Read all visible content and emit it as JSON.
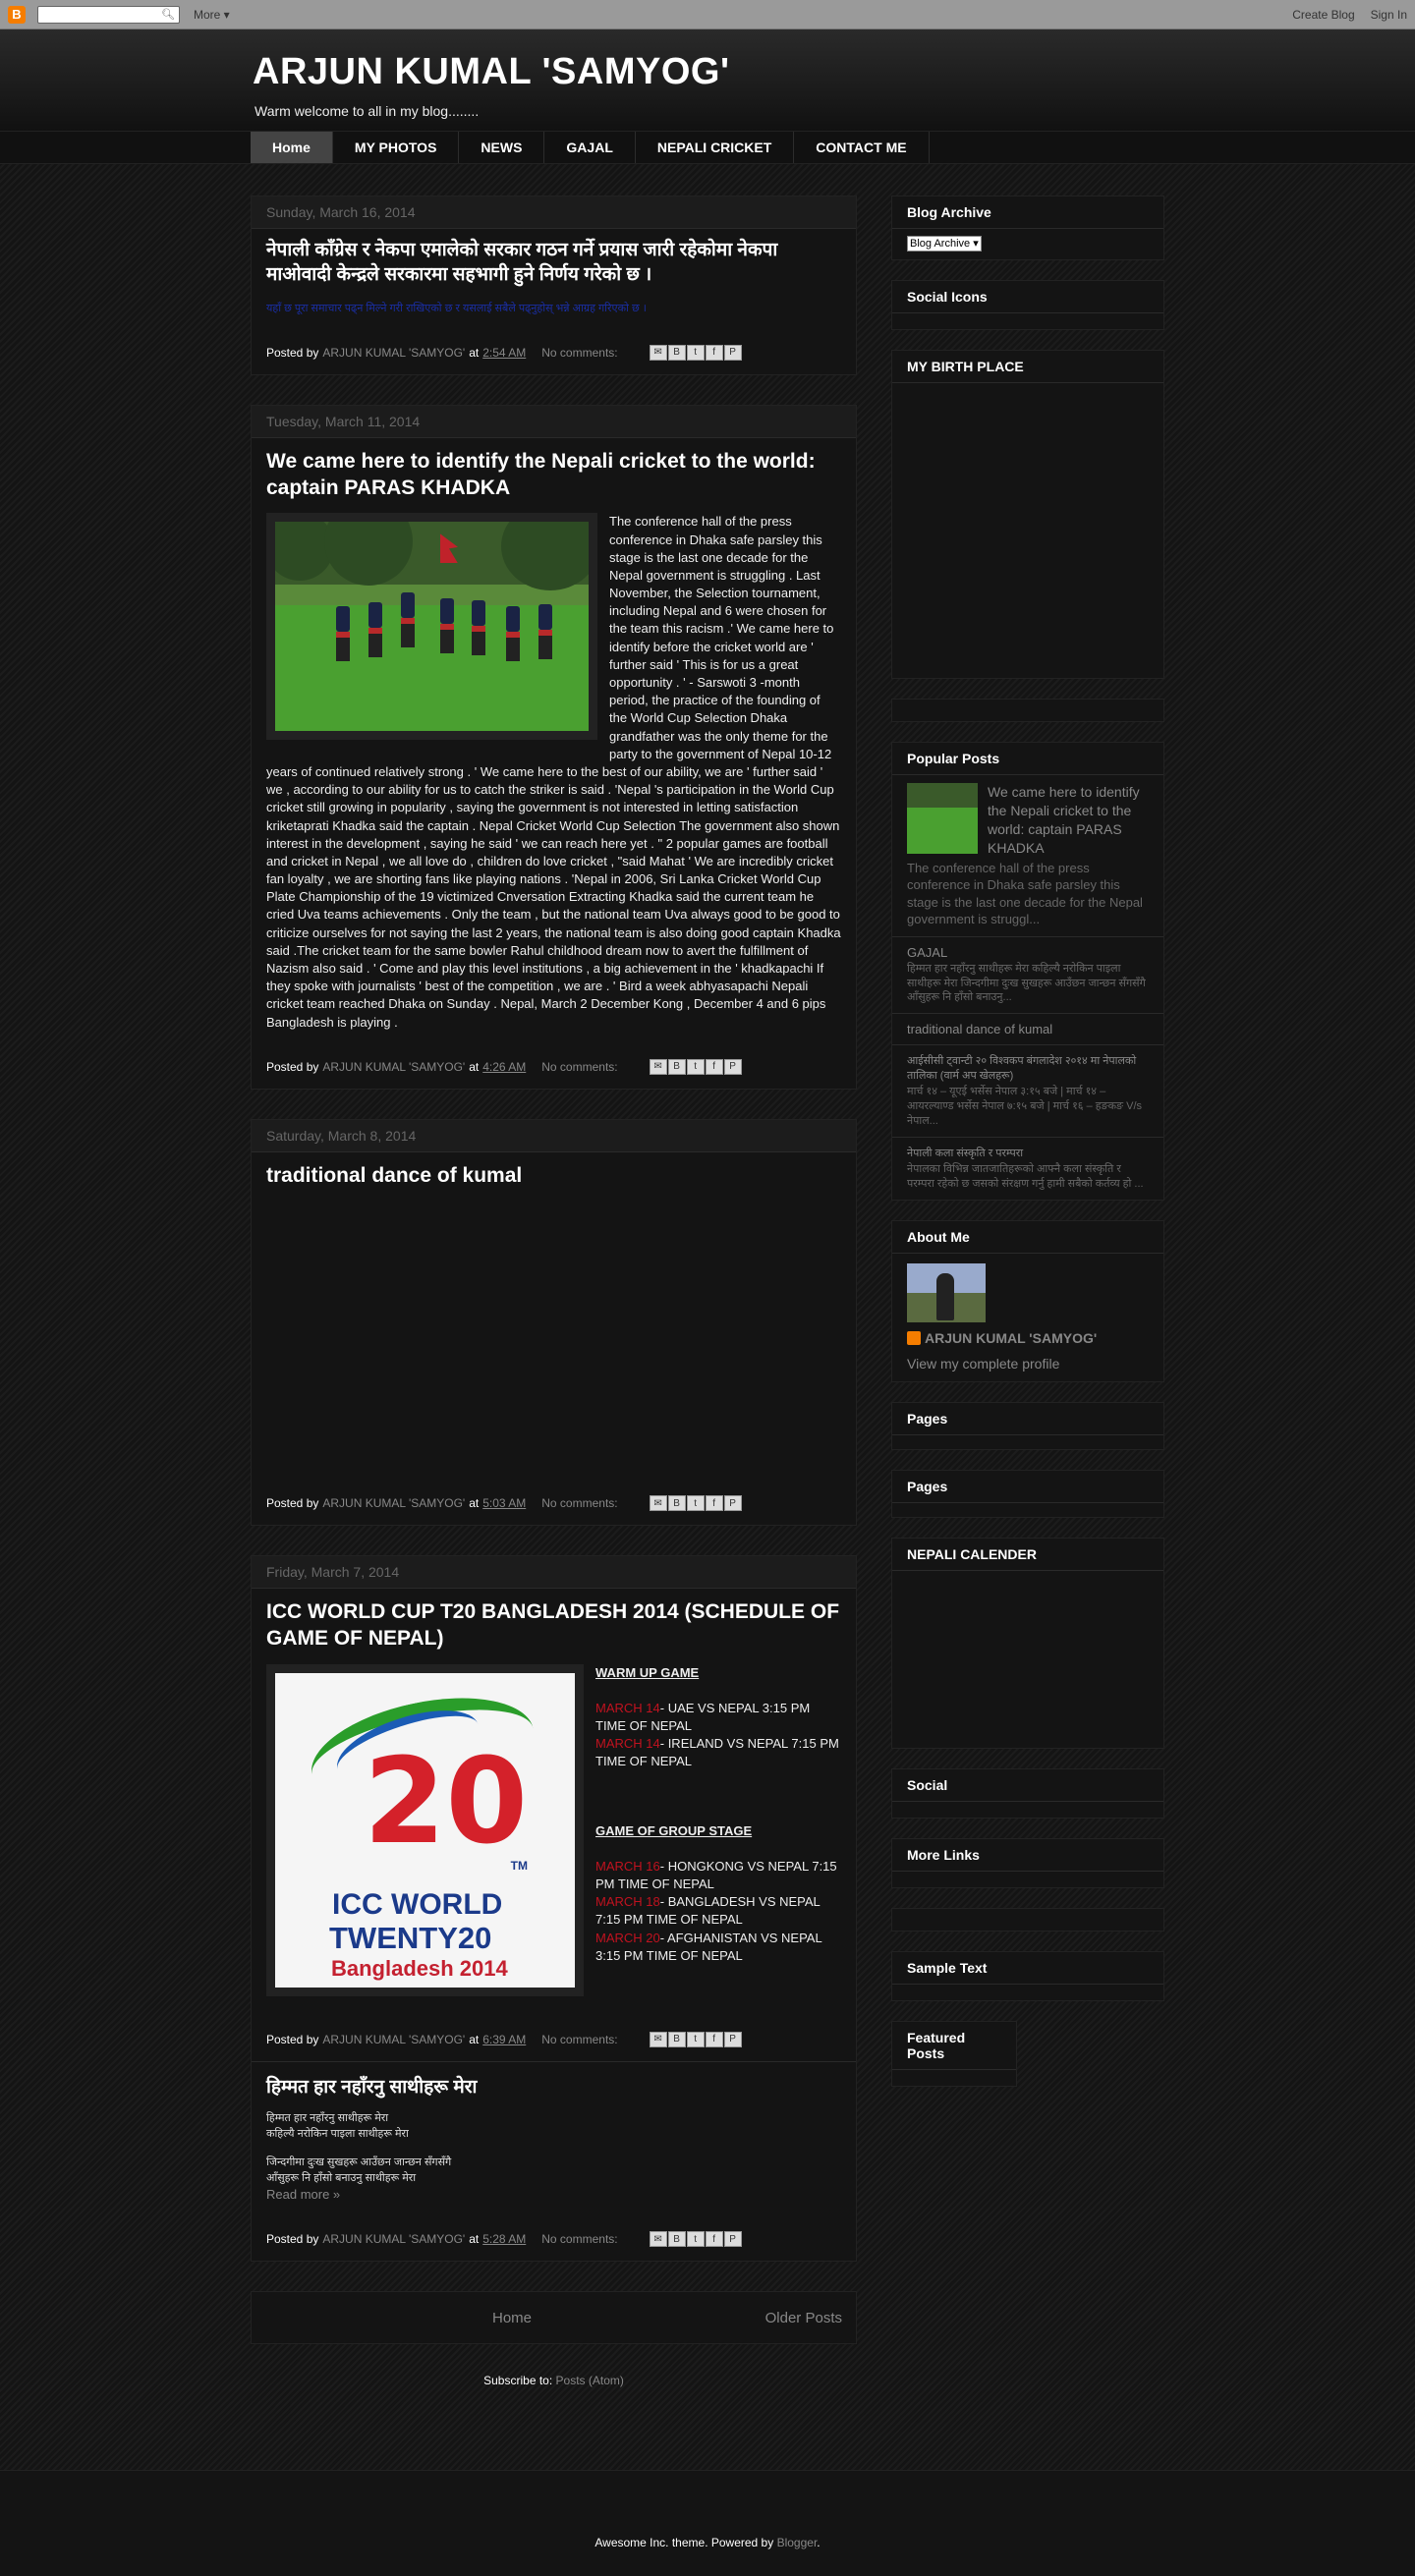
{
  "navbar": {
    "logo": "B",
    "more": "More",
    "create_blog": "Create Blog",
    "sign_in": "Sign In"
  },
  "header": {
    "title": "ARJUN KUMAL 'SAMYOG'",
    "description": "Warm welcome to all in my blog........"
  },
  "tabs": [
    "Home",
    "MY PHOTOS",
    "NEWS",
    "GAJAL",
    "NEPALI CRICKET",
    "CONTACT ME"
  ],
  "posts": [
    {
      "date": "Sunday, March 16, 2014",
      "title": "नेपाली काँग्रेस र नेकपा एमालेको सरकार गठन गर्ने प्रयास जारी रहेकोमा नेकपा माओवादी केन्द्रले सरकारमा सहभागी हुने निर्णय गरेको छ ।",
      "link": "यहाँ छ पूरा समाचार पढ्न मिल्ने गरी राखिएको छ र यसलाई सबैले पढ्नुहोस् भन्ने आग्रह गरिएको छ ।",
      "author": "ARJUN KUMAL 'SAMYOG'",
      "time": "2:54 AM",
      "comments": "No comments:"
    },
    {
      "date": "Tuesday, March 11, 2014",
      "title": "We came here to identify the Nepali cricket to the world: captain PARAS KHADKA",
      "body": "The conference hall of the press conference in Dhaka safe parsley this stage is the last one decade for the Nepal government is struggling . Last November, the Selection tournament, including Nepal and 6 were chosen for the team this racism .' We came here to identify before the cricket world are ' further said ' This is for us a great opportunity . ' - Sarswoti 3 -month period, the practice of the founding of the World Cup Selection Dhaka grandfather was the only theme for the party to the government of Nepal 10-12 years of continued relatively strong . ' We came here to the best of our ability, we are ' further said ' we , according to our ability for us to catch the striker is said . 'Nepal 's participation in the World Cup cricket still growing in popularity , saying the government is not interested in letting satisfaction kriketaprati Khadka said the captain . Nepal Cricket World Cup Selection The government also shown interest in the development , saying he said ' we can reach here yet . \" 2 popular games are football and cricket in Nepal , we all love do , children do love cricket , \"said Mahat ' We are incredibly cricket fan loyalty , we are shorting fans like playing nations . 'Nepal in 2006, Sri Lanka Cricket World Cup Plate Championship of the 19 victimized Cnversation Extracting Khadka said the current team he cried Uva teams achievements . Only the team , but the national team Uva always good to be good to criticize ourselves for not saying the last 2 years, the national team is also doing good captain Khadka said .The cricket team for the same bowler Rahul childhood dream now to avert the fulfillment of Nazism also said . ' Come and play this level institutions , a big achievement in the ' khadkapachi If they spoke with journalists ' best of the competition , we are . ' Bird a week abhyasapachi Nepali cricket team reached Dhaka on Sunday . Nepal, March 2 December Kong , December 4 and 6 pips Bangladesh is playing .",
      "author": "ARJUN KUMAL 'SAMYOG'",
      "time": "4:26 AM",
      "comments": "No comments:"
    },
    {
      "date": "Saturday, March 8, 2014",
      "title": "traditional dance of kumal",
      "author": "ARJUN KUMAL 'SAMYOG'",
      "time": "5:03 AM",
      "comments": "No comments:"
    },
    {
      "date": "Friday, March 7, 2014",
      "title": "ICC WORLD CUP T20 BANGLADESH 2014 (SCHEDULE OF GAME OF NEPAL)",
      "logo": {
        "num": "20",
        "tm": "TM",
        "line1": "ICC WORLD",
        "line2": "TWENTY20",
        "line3": "Bangladesh 2014"
      },
      "warmup_head": "WARM UP GAME",
      "warmup": [
        {
          "date": "MARCH 14",
          "text": "- UAE VS NEPAL 3:15 PM TIME OF NEPAL"
        },
        {
          "date": "MARCH 14",
          "text": "- IRELAND VS NEPAL 7:15 PM TIME OF NEPAL"
        }
      ],
      "group_head": "GAME OF GROUP STAGE",
      "group": [
        {
          "date": "MARCH 16",
          "text": "- HONGKONG VS NEPAL 7:15 PM TIME OF NEPAL"
        },
        {
          "date": "MARCH 18",
          "text": "- BANGLADESH VS NEPAL 7:15 PM TIME OF NEPAL"
        },
        {
          "date": "MARCH 20",
          "text": "- AFGHANISTAN VS NEPAL 3:15 PM TIME OF NEPAL"
        }
      ],
      "author": "ARJUN KUMAL 'SAMYOG'",
      "time": "6:39 AM",
      "comments": "No comments:"
    },
    {
      "title": "हिम्मत हार नहाँरनु साथीहरू मेरा",
      "lines": [
        "हिम्मत हार नहाँरनु साथीहरू मेरा",
        "कहिल्यै नरोकिन पाइला साथीहरू मेरा",
        "",
        "जिन्दगीमा दुःख सुखहरू आउँछन जान्छन सँगसँगै",
        "आँसुहरू नि हाँसो बनाउनु साथीहरू मेरा"
      ],
      "read_more": "Read more »",
      "author": "ARJUN KUMAL 'SAMYOG'",
      "time": "5:28 AM",
      "comments": "No comments:"
    }
  ],
  "footer_labels": {
    "posted_by": "Posted by",
    "at": "at"
  },
  "pager": {
    "home": "Home",
    "older": "Older Posts"
  },
  "subscribe": {
    "label": "Subscribe to:",
    "link": "Posts (Atom)"
  },
  "sidebar": {
    "archive": {
      "title": "Blog Archive",
      "select": "Blog Archive ▾"
    },
    "social_icons": "Social Icons",
    "birth_place": "MY BIRTH PLACE",
    "popular": {
      "title": "Popular Posts",
      "first_title": "We came here to identify the Nepali cricket to the world: captain PARAS KHADKA",
      "first_snip": "The conference hall of the press conference in Dhaka safe parsley this stage is the last one decade for the Nepal government is struggl...",
      "items": [
        {
          "title": "GAJAL",
          "snip": "हिम्मत हार नहाँरनु साथीहरू मेरा कहिल्यै नरोकिन पाइला साथीहरू मेरा जिन्दगीमा दुःख सुखहरू आउँछन जान्छन सँगसँगै आँसुहरू नि हाँसो बनाउनु..."
        },
        {
          "title": "traditional dance of kumal",
          "snip": ""
        },
        {
          "title": "आईसीसी ट्वान्टी २० विश्वकप बंगलादेश २०१४ मा नेपालको तालिका (वार्म अप खेलहरू)",
          "snip": "मार्च १४ – यूएई भर्सेस नेपाल ३:१५ बजे | मार्च १४ – आयरल्याण्ड भर्सेस नेपाल ७:१५ बजे | मार्च १६ – हङकङ V/s नेपाल..."
        },
        {
          "title": "नेपाली कला संस्कृति र परम्परा",
          "snip": "नेपालका विभिन्न जातजातिहरूको आफ्नै कला संस्कृति र परम्परा रहेको छ जसको संरक्षण गर्नु हामी सबैको कर्तव्य हो ..."
        }
      ]
    },
    "about": {
      "title": "About Me",
      "name": "ARJUN KUMAL 'SAMYOG'",
      "profile": "View my complete profile"
    },
    "pages1": "Pages",
    "pages2": "Pages",
    "calendar": "NEPALI CALENDER",
    "social": "Social",
    "more_links": "More Links",
    "sample_text": "Sample Text",
    "featured": "Featured Posts"
  },
  "footer": {
    "text": "Awesome Inc. theme. Powered by",
    "link": "Blogger",
    "end": "."
  }
}
